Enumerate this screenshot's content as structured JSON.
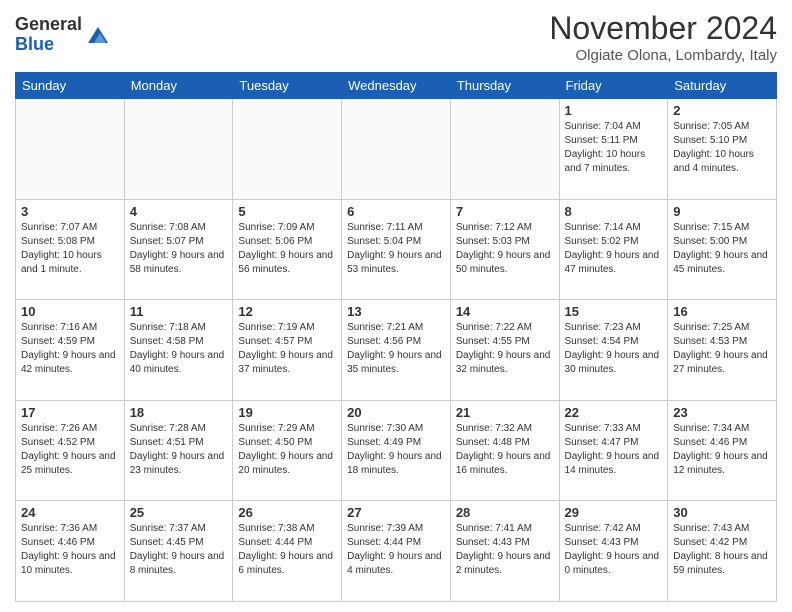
{
  "header": {
    "logo_general": "General",
    "logo_blue": "Blue",
    "month_title": "November 2024",
    "location": "Olgiate Olona, Lombardy, Italy"
  },
  "days_of_week": [
    "Sunday",
    "Monday",
    "Tuesday",
    "Wednesday",
    "Thursday",
    "Friday",
    "Saturday"
  ],
  "weeks": [
    [
      {
        "day": "",
        "info": ""
      },
      {
        "day": "",
        "info": ""
      },
      {
        "day": "",
        "info": ""
      },
      {
        "day": "",
        "info": ""
      },
      {
        "day": "",
        "info": ""
      },
      {
        "day": "1",
        "info": "Sunrise: 7:04 AM\nSunset: 5:11 PM\nDaylight: 10 hours and 7 minutes."
      },
      {
        "day": "2",
        "info": "Sunrise: 7:05 AM\nSunset: 5:10 PM\nDaylight: 10 hours and 4 minutes."
      }
    ],
    [
      {
        "day": "3",
        "info": "Sunrise: 7:07 AM\nSunset: 5:08 PM\nDaylight: 10 hours and 1 minute."
      },
      {
        "day": "4",
        "info": "Sunrise: 7:08 AM\nSunset: 5:07 PM\nDaylight: 9 hours and 58 minutes."
      },
      {
        "day": "5",
        "info": "Sunrise: 7:09 AM\nSunset: 5:06 PM\nDaylight: 9 hours and 56 minutes."
      },
      {
        "day": "6",
        "info": "Sunrise: 7:11 AM\nSunset: 5:04 PM\nDaylight: 9 hours and 53 minutes."
      },
      {
        "day": "7",
        "info": "Sunrise: 7:12 AM\nSunset: 5:03 PM\nDaylight: 9 hours and 50 minutes."
      },
      {
        "day": "8",
        "info": "Sunrise: 7:14 AM\nSunset: 5:02 PM\nDaylight: 9 hours and 47 minutes."
      },
      {
        "day": "9",
        "info": "Sunrise: 7:15 AM\nSunset: 5:00 PM\nDaylight: 9 hours and 45 minutes."
      }
    ],
    [
      {
        "day": "10",
        "info": "Sunrise: 7:16 AM\nSunset: 4:59 PM\nDaylight: 9 hours and 42 minutes."
      },
      {
        "day": "11",
        "info": "Sunrise: 7:18 AM\nSunset: 4:58 PM\nDaylight: 9 hours and 40 minutes."
      },
      {
        "day": "12",
        "info": "Sunrise: 7:19 AM\nSunset: 4:57 PM\nDaylight: 9 hours and 37 minutes."
      },
      {
        "day": "13",
        "info": "Sunrise: 7:21 AM\nSunset: 4:56 PM\nDaylight: 9 hours and 35 minutes."
      },
      {
        "day": "14",
        "info": "Sunrise: 7:22 AM\nSunset: 4:55 PM\nDaylight: 9 hours and 32 minutes."
      },
      {
        "day": "15",
        "info": "Sunrise: 7:23 AM\nSunset: 4:54 PM\nDaylight: 9 hours and 30 minutes."
      },
      {
        "day": "16",
        "info": "Sunrise: 7:25 AM\nSunset: 4:53 PM\nDaylight: 9 hours and 27 minutes."
      }
    ],
    [
      {
        "day": "17",
        "info": "Sunrise: 7:26 AM\nSunset: 4:52 PM\nDaylight: 9 hours and 25 minutes."
      },
      {
        "day": "18",
        "info": "Sunrise: 7:28 AM\nSunset: 4:51 PM\nDaylight: 9 hours and 23 minutes."
      },
      {
        "day": "19",
        "info": "Sunrise: 7:29 AM\nSunset: 4:50 PM\nDaylight: 9 hours and 20 minutes."
      },
      {
        "day": "20",
        "info": "Sunrise: 7:30 AM\nSunset: 4:49 PM\nDaylight: 9 hours and 18 minutes."
      },
      {
        "day": "21",
        "info": "Sunrise: 7:32 AM\nSunset: 4:48 PM\nDaylight: 9 hours and 16 minutes."
      },
      {
        "day": "22",
        "info": "Sunrise: 7:33 AM\nSunset: 4:47 PM\nDaylight: 9 hours and 14 minutes."
      },
      {
        "day": "23",
        "info": "Sunrise: 7:34 AM\nSunset: 4:46 PM\nDaylight: 9 hours and 12 minutes."
      }
    ],
    [
      {
        "day": "24",
        "info": "Sunrise: 7:36 AM\nSunset: 4:46 PM\nDaylight: 9 hours and 10 minutes."
      },
      {
        "day": "25",
        "info": "Sunrise: 7:37 AM\nSunset: 4:45 PM\nDaylight: 9 hours and 8 minutes."
      },
      {
        "day": "26",
        "info": "Sunrise: 7:38 AM\nSunset: 4:44 PM\nDaylight: 9 hours and 6 minutes."
      },
      {
        "day": "27",
        "info": "Sunrise: 7:39 AM\nSunset: 4:44 PM\nDaylight: 9 hours and 4 minutes."
      },
      {
        "day": "28",
        "info": "Sunrise: 7:41 AM\nSunset: 4:43 PM\nDaylight: 9 hours and 2 minutes."
      },
      {
        "day": "29",
        "info": "Sunrise: 7:42 AM\nSunset: 4:43 PM\nDaylight: 9 hours and 0 minutes."
      },
      {
        "day": "30",
        "info": "Sunrise: 7:43 AM\nSunset: 4:42 PM\nDaylight: 8 hours and 59 minutes."
      }
    ]
  ]
}
